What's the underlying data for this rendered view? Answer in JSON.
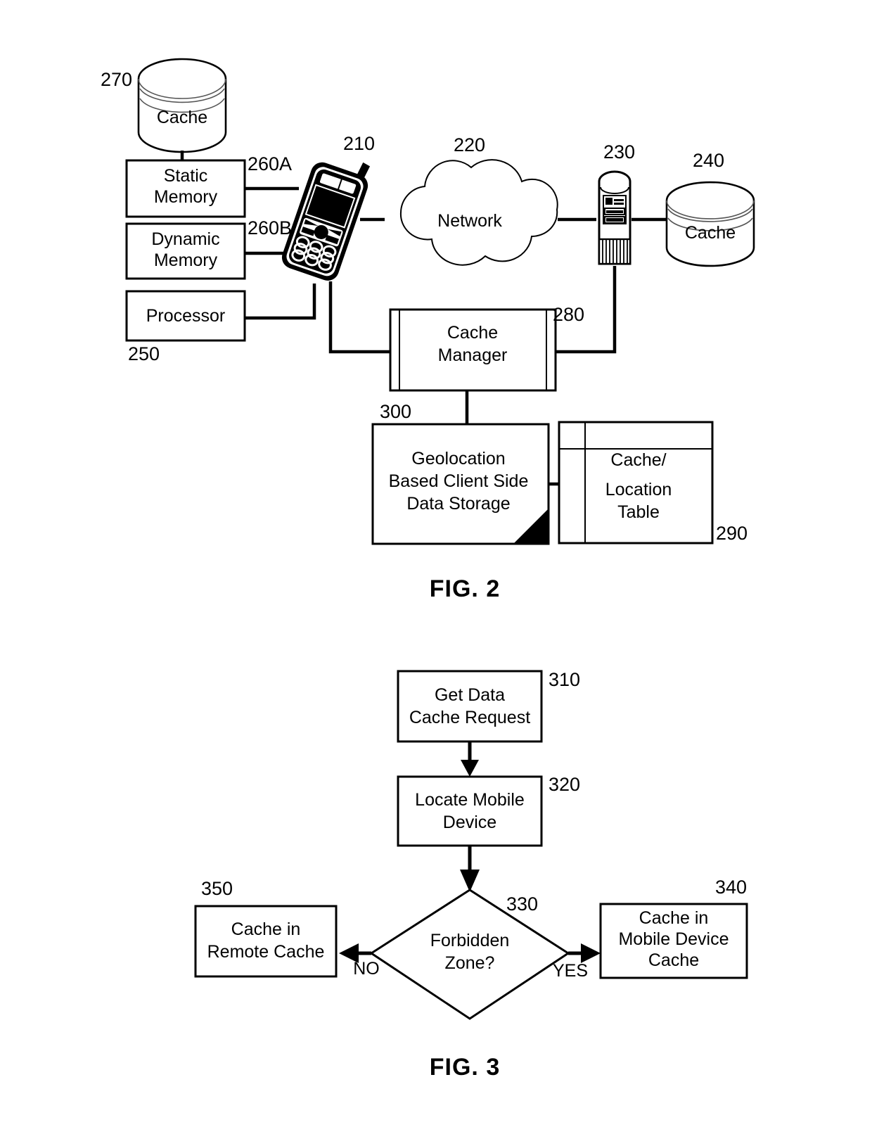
{
  "document": {
    "kind": "patent-drawing-sheet",
    "figures": [
      "FIG. 2",
      "FIG. 3"
    ]
  },
  "fig2": {
    "caption": "FIG. 2",
    "nodes": {
      "cache_top": {
        "label": "Cache",
        "ref": "270",
        "shape": "cylinder"
      },
      "static_memory": {
        "label_line1": "Static",
        "label_line2": "Memory",
        "ref": "260A",
        "shape": "rect"
      },
      "dynamic_memory": {
        "label_line1": "Dynamic",
        "label_line2": "Memory",
        "ref": "260B",
        "shape": "rect"
      },
      "processor": {
        "label": "Processor",
        "ref": "250",
        "shape": "rect"
      },
      "mobile_device": {
        "label": "",
        "ref": "210",
        "shape": "mobile-phone"
      },
      "network": {
        "label": "Network",
        "ref": "220",
        "shape": "cloud"
      },
      "server": {
        "label": "",
        "ref": "230",
        "shape": "server-tower"
      },
      "cache_remote": {
        "label": "Cache",
        "ref": "240",
        "shape": "cylinder"
      },
      "cache_manager": {
        "label_line1": "Cache",
        "label_line2": "Manager",
        "ref": "280",
        "shape": "module"
      },
      "geolocation_storage": {
        "label_line1": "Geolocation",
        "label_line2": "Based Client Side",
        "label_line3": "Data Storage",
        "ref": "300",
        "shape": "document-rect"
      },
      "cache_location_table": {
        "label_line1": "Cache/",
        "label_line2": "Location",
        "label_line3": "Table",
        "ref": "290",
        "shape": "table"
      }
    }
  },
  "fig3": {
    "caption": "FIG. 3",
    "nodes": {
      "get_data_cache_request": {
        "label_line1": "Get Data",
        "label_line2": "Cache Request",
        "ref": "310",
        "shape": "process"
      },
      "locate_mobile_device": {
        "label_line1": "Locate Mobile",
        "label_line2": "Device",
        "ref": "320",
        "shape": "process"
      },
      "forbidden_zone": {
        "label_line1": "Forbidden",
        "label_line2": "Zone?",
        "ref": "330",
        "shape": "decision"
      },
      "cache_in_remote_cache": {
        "label_line1": "Cache in",
        "label_line2": "Remote Cache",
        "ref": "350",
        "shape": "process"
      },
      "cache_in_mobile_device_cache": {
        "label_line1": "Cache in",
        "label_line2": "Mobile Device",
        "label_line3": "Cache",
        "ref": "340",
        "shape": "process"
      }
    },
    "edges": {
      "no_label": "NO",
      "yes_label": "YES"
    }
  },
  "colors": {
    "ink": "#000000",
    "paper": "#ffffff",
    "hairline": "#555555"
  }
}
